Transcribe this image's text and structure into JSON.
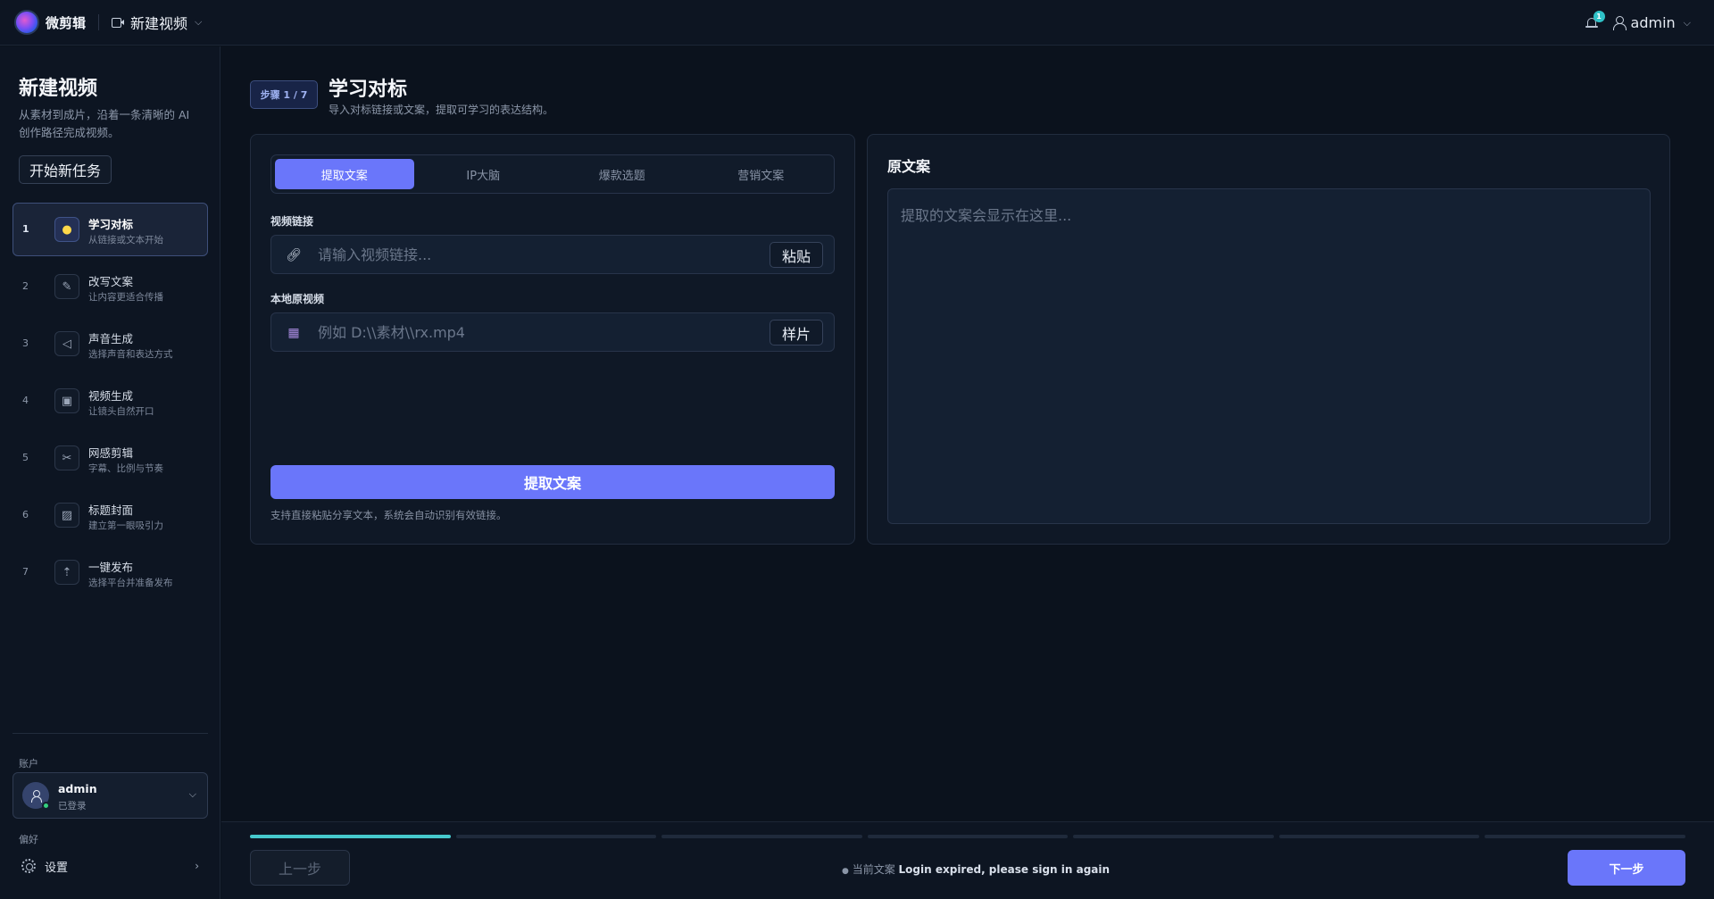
{
  "topbar": {
    "brand": "微剪辑",
    "project": "新建视频",
    "notification_count": "1",
    "user": "admin"
  },
  "sidebar": {
    "title": "新建视频",
    "description": "从素材到成片，沿着一条清晰的 AI 创作路径完成视频。",
    "new_task_label": "开始新任务",
    "steps": [
      {
        "num": "1",
        "name": "学习对标",
        "sub": "从链接或文本开始",
        "icon": "lightbulb-icon"
      },
      {
        "num": "2",
        "name": "改写文案",
        "sub": "让内容更适合传播",
        "icon": "pencil-icon"
      },
      {
        "num": "3",
        "name": "声音生成",
        "sub": "选择声音和表达方式",
        "icon": "sound-icon"
      },
      {
        "num": "4",
        "name": "视频生成",
        "sub": "让镜头自然开口",
        "icon": "video-frame-icon"
      },
      {
        "num": "5",
        "name": "网感剪辑",
        "sub": "字幕、比例与节奏",
        "icon": "scissors-icon"
      },
      {
        "num": "6",
        "name": "标题封面",
        "sub": "建立第一眼吸引力",
        "icon": "cover-image-icon"
      },
      {
        "num": "7",
        "name": "一键发布",
        "sub": "选择平台并准备发布",
        "icon": "publish-icon"
      }
    ],
    "account_label": "账户",
    "account_name": "admin",
    "account_status": "已登录",
    "preferences_label": "偏好",
    "settings_label": "设置"
  },
  "main": {
    "step_badge": "步骤 1 / 7",
    "title": "学习对标",
    "subtitle": "导入对标链接或文案，提取可学习的表达结构。",
    "tabs": [
      "提取文案",
      "IP大脑",
      "爆款选题",
      "营销文案"
    ],
    "video_link_label": "视频链接",
    "video_link_placeholder": "请输入视频链接...",
    "paste_label": "粘贴",
    "local_video_label": "本地原视频",
    "local_video_placeholder": "例如 D:\\\\素材\\\\rx.mp4",
    "sample_label": "样片",
    "extract_label": "提取文案",
    "hint": "支持直接粘贴分享文本，系统会自动识别有效链接。",
    "original_title": "原文案",
    "original_placeholder": "提取的文案会显示在这里..."
  },
  "footer": {
    "prev_label": "上一步",
    "status_prefix": "当前文案",
    "status_message": "Login expired, please sign in again",
    "next_label": "下一步",
    "progress": {
      "completed_steps": 1,
      "total_steps": 7
    }
  },
  "colors": {
    "accent": "#6a76fa",
    "progress": "#46c9cd",
    "background": "#0b121d",
    "badge": "#2fc2c8"
  }
}
